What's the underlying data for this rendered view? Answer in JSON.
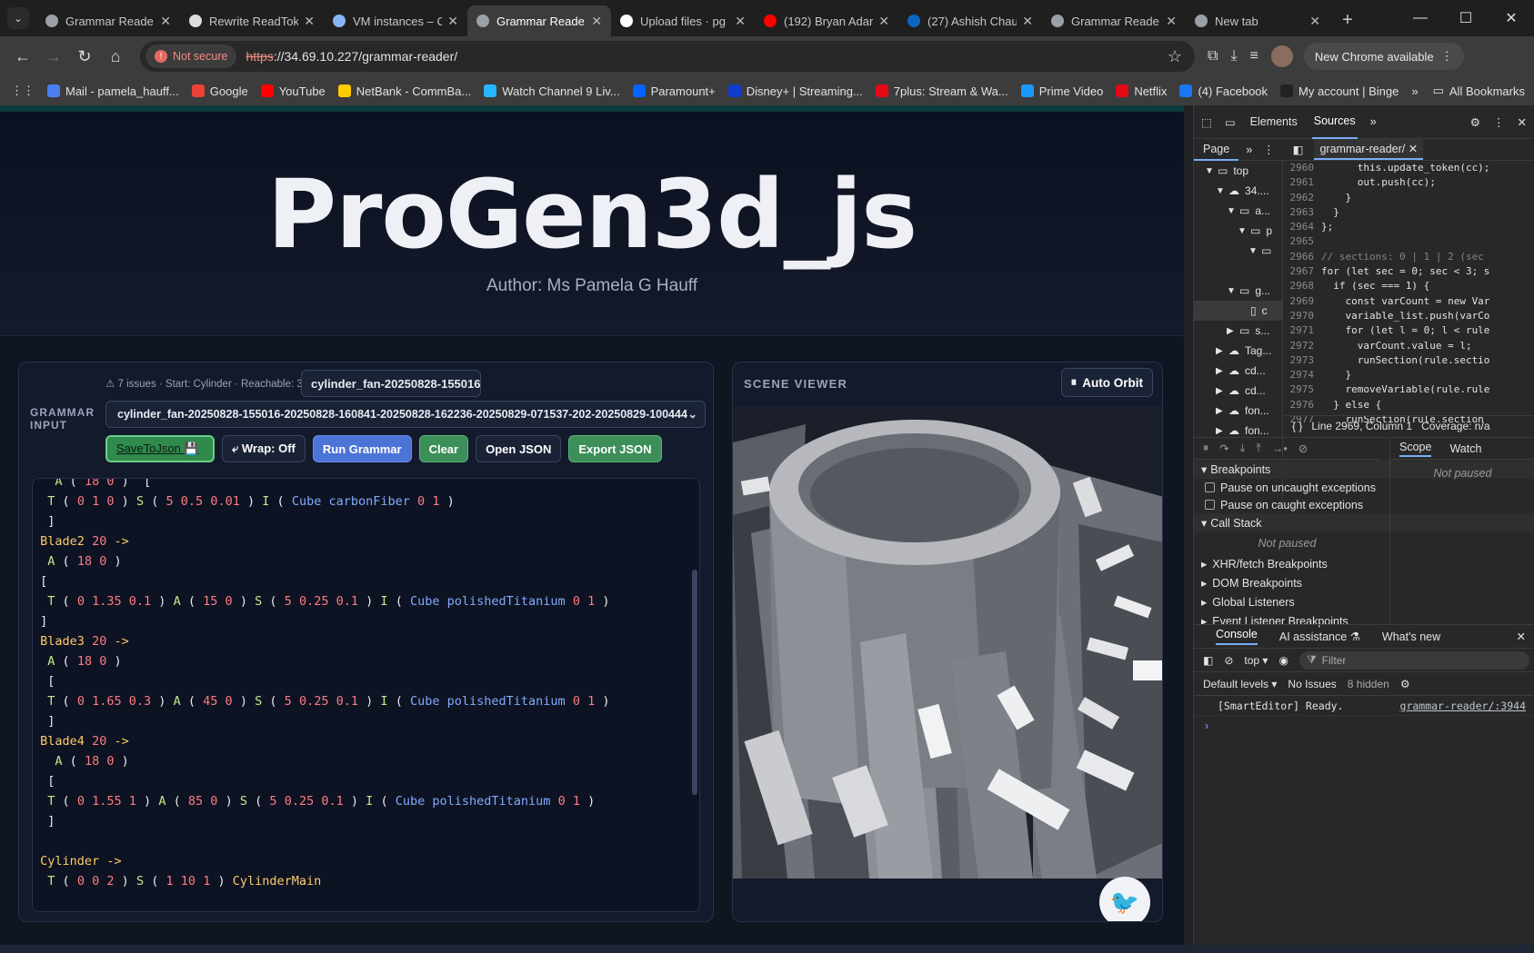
{
  "browser": {
    "tabs": [
      {
        "title": "Grammar Reade",
        "active": false,
        "icon": "globe-icon"
      },
      {
        "title": "Rewrite ReadTok",
        "active": false,
        "icon": "openai-icon"
      },
      {
        "title": "VM instances – C",
        "active": false,
        "icon": "gcp-icon"
      },
      {
        "title": "Grammar Reade",
        "active": true,
        "icon": "globe-icon"
      },
      {
        "title": "Upload files · pg",
        "active": false,
        "icon": "github-icon"
      },
      {
        "title": "(192) Bryan Adar",
        "active": false,
        "icon": "youtube-icon"
      },
      {
        "title": "(27) Ashish Chau",
        "active": false,
        "icon": "linkedin-icon"
      },
      {
        "title": "Grammar Reade",
        "active": false,
        "icon": "globe-icon"
      },
      {
        "title": "New tab",
        "active": false,
        "icon": "chrome-icon"
      }
    ],
    "security": "Not secure",
    "url_scheme": "https",
    "url_rest": "://34.69.10.227/grammar-reader/",
    "new_chrome": "New Chrome available",
    "bookmarks": [
      {
        "label": "Mail - pamela_hauff...",
        "color": "#4a7ef0"
      },
      {
        "label": "Google",
        "color": "#ea4335"
      },
      {
        "label": "YouTube",
        "color": "#ff0000"
      },
      {
        "label": "NetBank - CommBa...",
        "color": "#ffcc00"
      },
      {
        "label": "Watch Channel 9 Liv...",
        "color": "#27b7ff"
      },
      {
        "label": "Paramount+",
        "color": "#0064ff"
      },
      {
        "label": "Disney+ | Streaming...",
        "color": "#113ccf"
      },
      {
        "label": "7plus: Stream & Wa...",
        "color": "#e50914"
      },
      {
        "label": "Prime Video",
        "color": "#1a98ff"
      },
      {
        "label": "Netflix",
        "color": "#e50914"
      },
      {
        "label": "(4) Facebook",
        "color": "#1877f2"
      },
      {
        "label": "My account | Binge",
        "color": "#222222"
      }
    ],
    "all_bookmarks": "All Bookmarks"
  },
  "app": {
    "title": "ProGen3d_js",
    "author": "Author: Ms Pamela G Hauff",
    "issues": "⚠ 7 issues · Start: Cylinder · Reachable: 3",
    "name_value": "cylinder_fan-20250828-155016-",
    "grammar_label": "GRAMMAR INPUT",
    "grammar_select": "cylinder_fan-20250828-155016-20250828-160841-20250828-162236-20250829-071537-202-20250829-100444",
    "buttons": {
      "save": "SaveToJson 💾",
      "wrap": "⤶ Wrap: Off",
      "run": "Run Grammar",
      "clear": "Clear",
      "open": "Open JSON",
      "export": "Export JSON"
    },
    "viewer_title": "SCENE VIEWER",
    "auto_orbit": "Auto Orbit"
  },
  "code_lines": [
    "   A ( 18 0 )  [",
    "  T ( 0 1 0 ) S ( 5 0.5 0.01 ) I ( Cube carbonFiber 0 1 )",
    "  ]",
    " Blade2 20 ->",
    "  A ( 18 0 )",
    " [",
    "  T ( 0 1.35 0.1 ) A ( 15 0 ) S ( 5 0.25 0.1 ) I ( Cube polishedTitanium 0 1 )",
    " ]",
    " Blade3 20 ->",
    "  A ( 18 0 )",
    "  [",
    "  T ( 0 1.65 0.3 ) A ( 45 0 ) S ( 5 0.25 0.1 ) I ( Cube polishedTitanium 0 1 )",
    "  ]",
    " Blade4 20 ->",
    "   A ( 18 0 )",
    "  [",
    "  T ( 0 1.55 1 ) A ( 85 0 ) S ( 5 0.25 0.1 ) I ( Cube polishedTitanium 0 1 )",
    "  ]",
    "",
    " Cylinder ->",
    "  T ( 0 0 2 ) S ( 1 10 1 ) CylinderMain"
  ],
  "devtools": {
    "tabs": [
      "Elements",
      "Sources"
    ],
    "active_tab": "Sources",
    "page_tab": "Page",
    "file_tab": "grammar-reader/",
    "tree": [
      {
        "label": "top",
        "indent": 0,
        "arrow": "▼",
        "icon": "frame-icon"
      },
      {
        "label": "34....",
        "indent": 1,
        "arrow": "▼",
        "icon": "cloud-icon"
      },
      {
        "label": "a...",
        "indent": 2,
        "arrow": "▼",
        "icon": "folder-icon"
      },
      {
        "label": "p",
        "indent": 3,
        "arrow": "▼",
        "icon": "folder-icon"
      },
      {
        "label": "",
        "indent": 4,
        "arrow": "▼",
        "icon": "folder-icon"
      },
      {
        "label": "",
        "indent": 0,
        "arrow": "",
        "icon": ""
      },
      {
        "label": "g...",
        "indent": 2,
        "arrow": "▼",
        "icon": "folder-icon"
      },
      {
        "label": "c",
        "indent": 3,
        "arrow": "",
        "icon": "file-icon"
      },
      {
        "label": "s...",
        "indent": 2,
        "arrow": "▶",
        "icon": "folder-icon"
      },
      {
        "label": "Tag...",
        "indent": 1,
        "arrow": "▶",
        "icon": "cloud-icon"
      },
      {
        "label": "cd...",
        "indent": 1,
        "arrow": "▶",
        "icon": "cloud-icon"
      },
      {
        "label": "cd...",
        "indent": 1,
        "arrow": "▶",
        "icon": "cloud-icon"
      },
      {
        "label": "fon...",
        "indent": 1,
        "arrow": "▶",
        "icon": "cloud-icon"
      },
      {
        "label": "fon...",
        "indent": 1,
        "arrow": "▶",
        "icon": "cloud-icon"
      }
    ],
    "source": [
      {
        "n": "2960",
        "t": "      this.update_token(cc);"
      },
      {
        "n": "2961",
        "t": "      out.push(cc);"
      },
      {
        "n": "2962",
        "t": "    }"
      },
      {
        "n": "2963",
        "t": "  }"
      },
      {
        "n": "2964",
        "t": "};"
      },
      {
        "n": "2965",
        "t": ""
      },
      {
        "n": "2966",
        "t": "// sections: 0 | 1 | 2 (sec"
      },
      {
        "n": "2967",
        "t": "for (let sec = 0; sec < 3; s"
      },
      {
        "n": "2968",
        "t": "  if (sec === 1) {"
      },
      {
        "n": "2969",
        "t": "    const varCount = new Var"
      },
      {
        "n": "2970",
        "t": "    variable_list.push(varCo"
      },
      {
        "n": "2971",
        "t": "    for (let l = 0; l < rule"
      },
      {
        "n": "2972",
        "t": "      varCount.value = l;"
      },
      {
        "n": "2973",
        "t": "      runSection(rule.sectio"
      },
      {
        "n": "2974",
        "t": "    }"
      },
      {
        "n": "2975",
        "t": "    removeVariable(rule.rule"
      },
      {
        "n": "2976",
        "t": "  } else {"
      },
      {
        "n": "2977",
        "t": "    runSection(rule.section"
      }
    ],
    "status_pos": "Line 2969, Column 1",
    "coverage": "Coverage: n/a",
    "breakpoints": "Breakpoints",
    "pause_uncaught": "Pause on uncaught exceptions",
    "pause_caught": "Pause on caught exceptions",
    "call_stack": "Call Stack",
    "not_paused": "Not paused",
    "xhr": "XHR/fetch Breakpoints",
    "dom": "DOM Breakpoints",
    "global": "Global Listeners",
    "event": "Event Listener Breakpoints",
    "scope": "Scope",
    "watch": "Watch",
    "console_tabs": [
      "Console",
      "AI assistance ⚗",
      "What's new"
    ],
    "context": "top ▾",
    "filter": "Filter",
    "levels": "Default levels ▾",
    "no_issues": "No Issues",
    "hidden": "8 hidden",
    "msg": "[SmartEditor] Ready.",
    "msg_link": "grammar-reader/:3944",
    "prompt": "›"
  }
}
